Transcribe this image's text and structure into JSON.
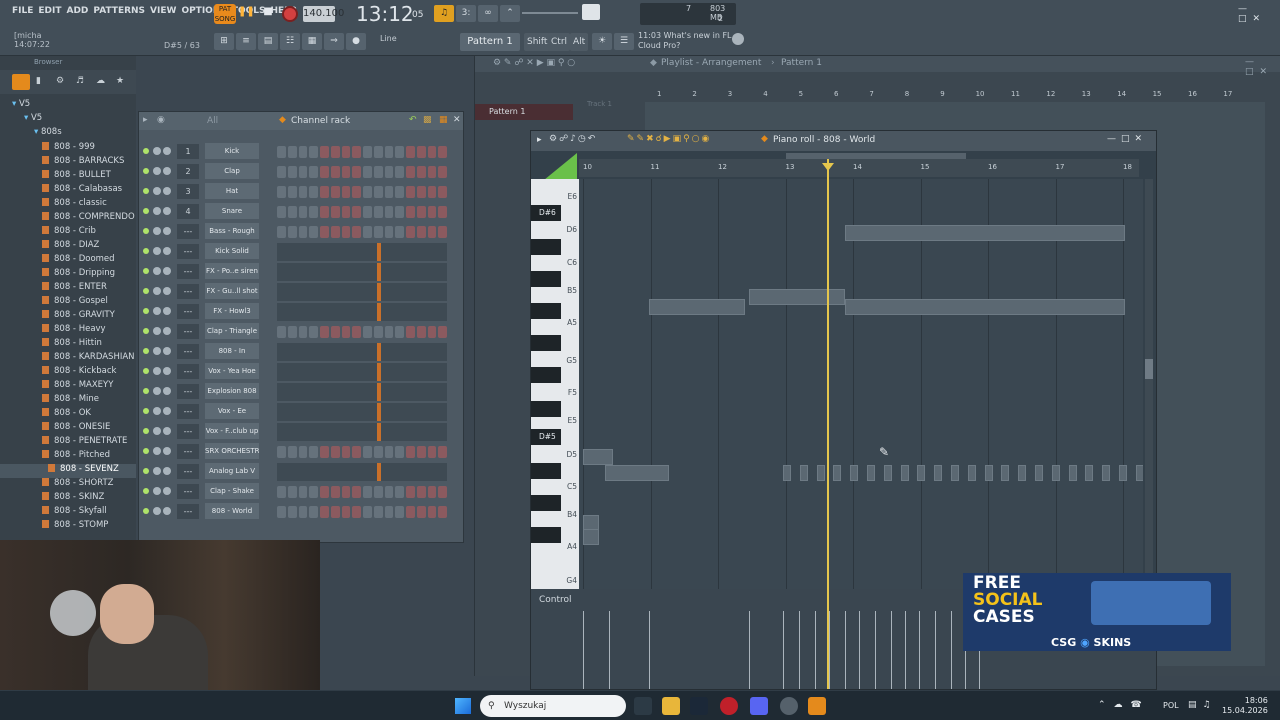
{
  "menu": [
    "FILE",
    "EDIT",
    "ADD",
    "PATTERNS",
    "VIEW",
    "OPTIONS",
    "TOOLS",
    "HELP"
  ],
  "transport": {
    "pat_label": "PAT",
    "song_label": "SONG",
    "tempo": "140.100",
    "time": "13:12",
    "time_ms": "05",
    "cpu_val": "7",
    "mem": "803 MB",
    "poly": "2"
  },
  "user": {
    "name": "[micha",
    "time": "14:07:22"
  },
  "note_info": "D#5 / 63",
  "line_mode": "Line",
  "pattern": "Pattern 1",
  "keys": [
    "Shift",
    "Ctrl",
    "Alt"
  ],
  "news": {
    "time": "11:03",
    "line1": "What's new in FL",
    "line2": "Cloud Pro?"
  },
  "browser": {
    "header": "Browser",
    "tree": [
      "V5",
      "V5",
      "808s"
    ],
    "items": [
      "808 - 999",
      "808 - BARRACKS",
      "808 - BULLET",
      "808 - Calabasas",
      "808 - classic",
      "808 - COMPRENDO",
      "808 - Crib",
      "808 - DIAZ",
      "808 - Doomed",
      "808 - Dripping",
      "808 - ENTER",
      "808 - Gospel",
      "808 - GRAVITY",
      "808 - Heavy",
      "808 - Hittin",
      "808 - KARDASHIAN",
      "808 - Kickback",
      "808 - MAXEYY",
      "808 - Mine",
      "808 - OK",
      "808 - ONESIE",
      "808 - PENETRATE",
      "808 - Pitched",
      "808 - SEVENZ",
      "808 - SHORTZ",
      "808 - SKINZ",
      "808 - Skyfall",
      "808 - STOMP"
    ],
    "selected": "808 - SEVENZ"
  },
  "channel_rack": {
    "title": "Channel rack",
    "filter": "All",
    "channels": [
      {
        "num": "1",
        "name": "Kick"
      },
      {
        "num": "2",
        "name": "Clap"
      },
      {
        "num": "3",
        "name": "Hat"
      },
      {
        "num": "4",
        "name": "Snare"
      },
      {
        "num": "---",
        "name": "Bass - Rough"
      },
      {
        "num": "---",
        "name": "Kick Solid"
      },
      {
        "num": "---",
        "name": "FX - Po..e siren"
      },
      {
        "num": "---",
        "name": "FX - Gu..ll shot"
      },
      {
        "num": "---",
        "name": "FX - Howl3"
      },
      {
        "num": "---",
        "name": "Clap - Triangle"
      },
      {
        "num": "---",
        "name": "808 - In"
      },
      {
        "num": "---",
        "name": "Vox - Yea Hoe"
      },
      {
        "num": "---",
        "name": "Explosion 808"
      },
      {
        "num": "---",
        "name": "Vox - Ee"
      },
      {
        "num": "---",
        "name": "Vox - F..club up"
      },
      {
        "num": "---",
        "name": "SRX ORCHESTRA"
      },
      {
        "num": "---",
        "name": "Analog Lab V"
      },
      {
        "num": "---",
        "name": "Clap - Shake"
      },
      {
        "num": "---",
        "name": "808 - World"
      }
    ]
  },
  "playlist": {
    "title": "Playlist - Arrangement",
    "pattern": "Pattern 1",
    "track": "Track 1",
    "picker_item": "Pattern 1",
    "ruler": [
      "1",
      "2",
      "3",
      "4",
      "5",
      "6",
      "7",
      "8",
      "9",
      "10",
      "11",
      "12",
      "13",
      "14",
      "15",
      "16",
      "17"
    ]
  },
  "piano_roll": {
    "title": "Piano roll - 808 - World",
    "ruler": [
      "10",
      "11",
      "12",
      "13",
      "14",
      "15",
      "16",
      "17",
      "18"
    ],
    "keys": [
      "E6",
      "D#6",
      "D6",
      "C6",
      "B5",
      "A5",
      "G5",
      "F5",
      "E5",
      "D#5",
      "D5",
      "C5",
      "B4",
      "A4",
      "G4"
    ],
    "control_label": "Control"
  },
  "ad": {
    "line1": "FREE",
    "line2": "SOCIAL",
    "line3": "CASES",
    "brand": "CSG",
    "brand2": "SKINS"
  },
  "taskbar": {
    "search": "Wyszukaj",
    "lang": "POL",
    "time": "18:06",
    "date": "15.04.2026"
  }
}
